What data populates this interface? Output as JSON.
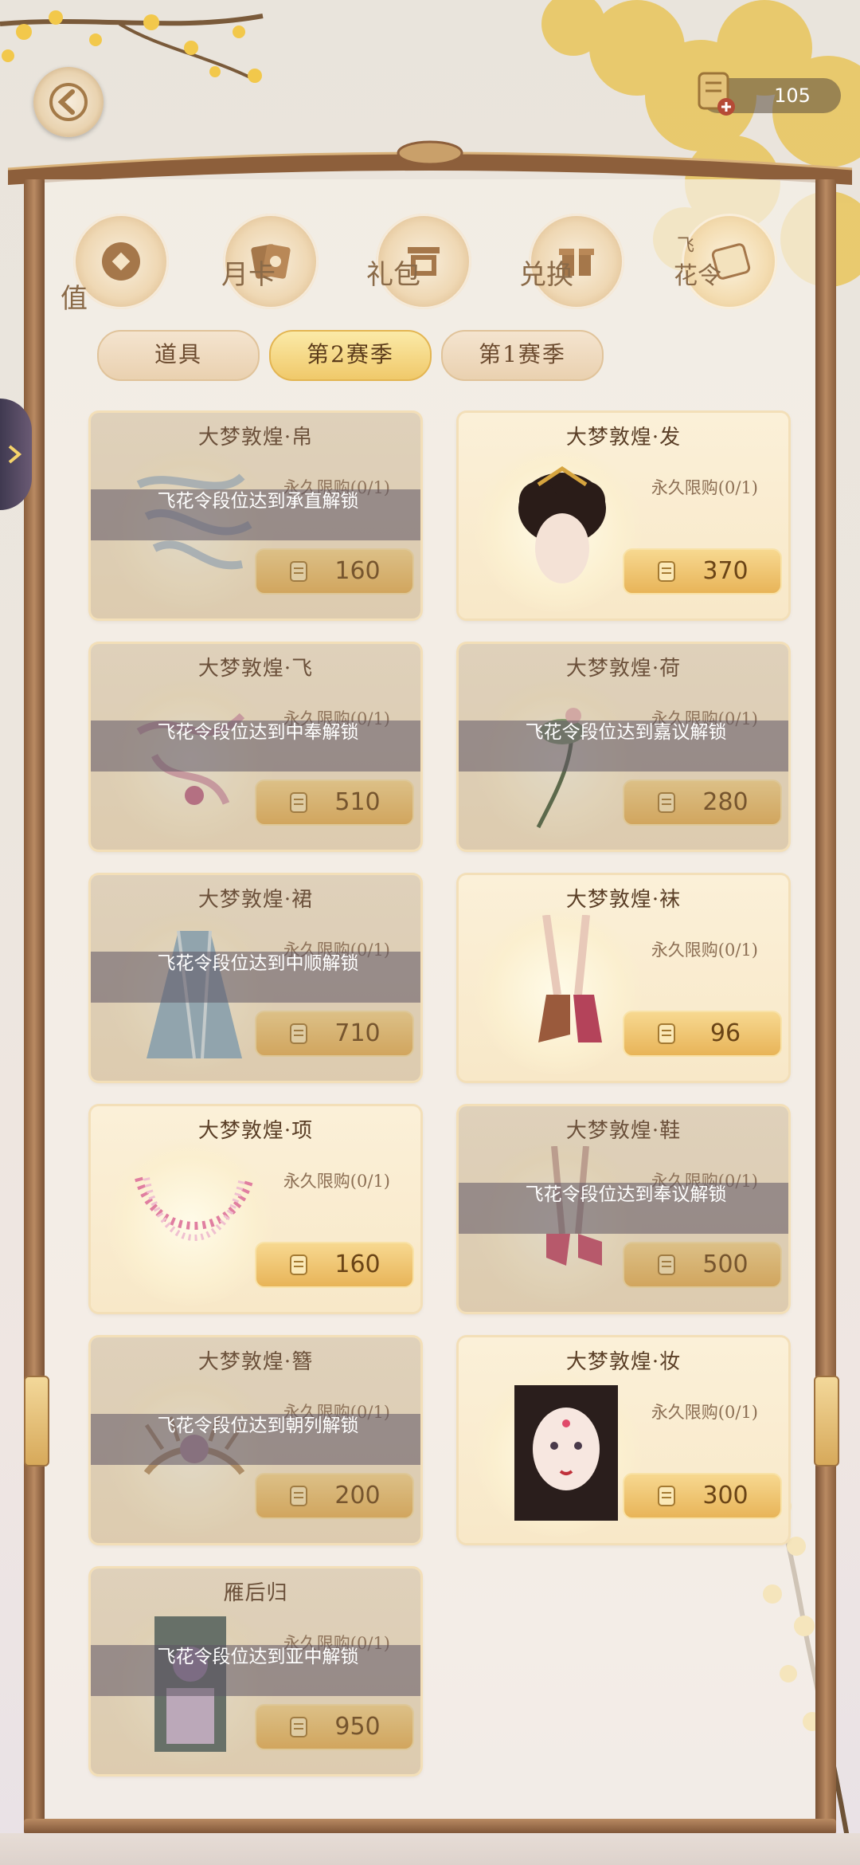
{
  "currency": {
    "value": "105",
    "icon": "scroll-coin-icon"
  },
  "categories": [
    {
      "label_top": "",
      "label": "值",
      "icon": "coin-icon"
    },
    {
      "label_top": "",
      "label": "月卡",
      "icon": "cards-icon"
    },
    {
      "label_top": "",
      "label": "礼包",
      "icon": "gift-box-icon"
    },
    {
      "label_top": "",
      "label": "兑换",
      "icon": "exchange-gift-icon"
    },
    {
      "label_top": "飞",
      "label": "花令",
      "icon": "scroll-icon"
    }
  ],
  "season_tabs": [
    {
      "label": "道具",
      "active": false
    },
    {
      "label": "第2赛季",
      "active": true
    },
    {
      "label": "第1赛季",
      "active": false
    }
  ],
  "items": [
    {
      "title": "大梦敦煌·帛",
      "limit": "永久限购(0/1)",
      "price": "160",
      "locked": true,
      "lock_text": "飞花令段位达到承直解锁",
      "art": "silk-ribbon"
    },
    {
      "title": "大梦敦煌·发",
      "limit": "永久限购(0/1)",
      "price": "370",
      "locked": false,
      "lock_text": "",
      "art": "hair"
    },
    {
      "title": "大梦敦煌·飞",
      "limit": "永久限购(0/1)",
      "price": "510",
      "locked": true,
      "lock_text": "飞花令段位达到中奉解锁",
      "art": "flying-sash"
    },
    {
      "title": "大梦敦煌·荷",
      "limit": "永久限购(0/1)",
      "price": "280",
      "locked": true,
      "lock_text": "飞花令段位达到嘉议解锁",
      "art": "lotus"
    },
    {
      "title": "大梦敦煌·裙",
      "limit": "永久限购(0/1)",
      "price": "710",
      "locked": true,
      "lock_text": "飞花令段位达到中顺解锁",
      "art": "skirt"
    },
    {
      "title": "大梦敦煌·袜",
      "limit": "永久限购(0/1)",
      "price": "96",
      "locked": false,
      "lock_text": "",
      "art": "socks"
    },
    {
      "title": "大梦敦煌·项",
      "limit": "永久限购(0/1)",
      "price": "160",
      "locked": false,
      "lock_text": "",
      "art": "necklace"
    },
    {
      "title": "大梦敦煌·鞋",
      "limit": "永久限购(0/1)",
      "price": "500",
      "locked": true,
      "lock_text": "飞花令段位达到奉议解锁",
      "art": "shoes"
    },
    {
      "title": "大梦敦煌·簪",
      "limit": "永久限购(0/1)",
      "price": "200",
      "locked": true,
      "lock_text": "飞花令段位达到朝列解锁",
      "art": "hairpin"
    },
    {
      "title": "大梦敦煌·妆",
      "limit": "永久限购(0/1)",
      "price": "300",
      "locked": false,
      "lock_text": "",
      "art": "makeup"
    },
    {
      "title": "雁后归",
      "limit": "永久限购(0/1)",
      "price": "950",
      "locked": true,
      "lock_text": "飞花令段位达到亚中解锁",
      "art": "portrait-card"
    }
  ]
}
